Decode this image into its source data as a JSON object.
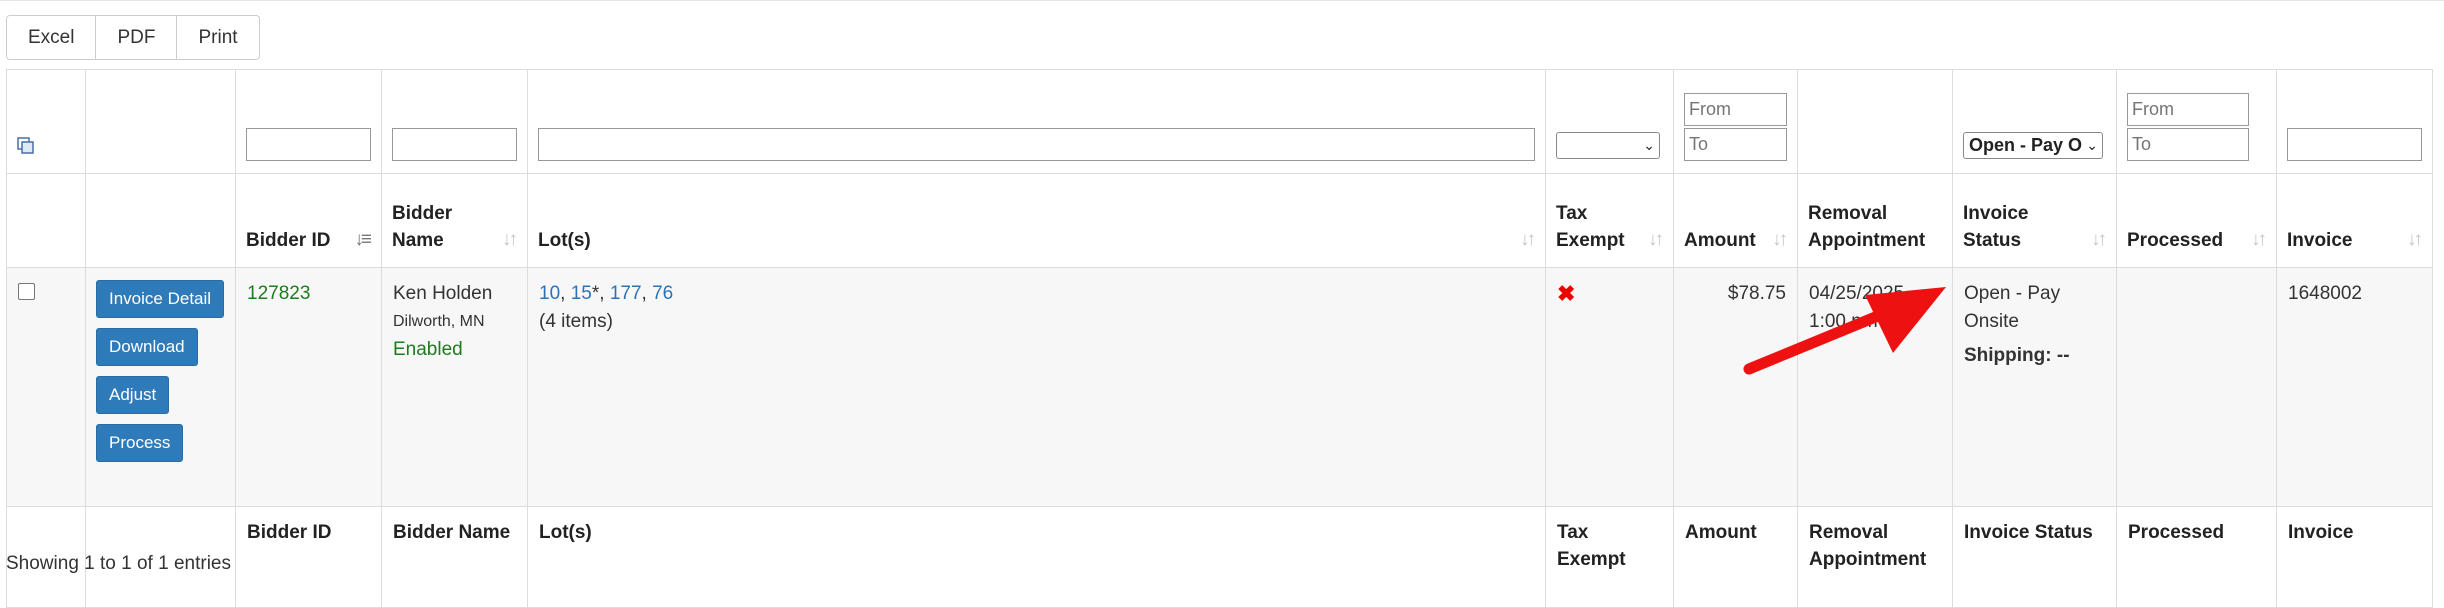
{
  "export_buttons": {
    "excel": "Excel",
    "pdf": "PDF",
    "print": "Print"
  },
  "filters": {
    "amount_from": "From",
    "amount_to": "To",
    "invoice_status_selected": "Open - Pay Onsite",
    "processed_from": "From",
    "processed_to": "To"
  },
  "columns": {
    "bidder_id": "Bidder ID",
    "bidder_name": [
      "Bidder",
      "Name"
    ],
    "lots": "Lot(s)",
    "tax_exempt": [
      "Tax",
      "Exempt"
    ],
    "amount": "Amount",
    "removal_appointment": [
      "Removal",
      "Appointment"
    ],
    "invoice_status": [
      "Invoice",
      "Status"
    ],
    "processed": "Processed",
    "invoice": "Invoice"
  },
  "footer_columns": {
    "bidder_id": "Bidder ID",
    "bidder_name": "Bidder Name",
    "lots": "Lot(s)",
    "tax_exempt": "Tax Exempt",
    "amount": "Amount",
    "removal_appointment": [
      "Removal",
      "Appointment"
    ],
    "invoice_status": "Invoice Status",
    "processed": "Processed",
    "invoice": "Invoice"
  },
  "row": {
    "actions": {
      "invoice_detail": "Invoice Detail",
      "download": "Download",
      "adjust": "Adjust",
      "process": "Process"
    },
    "bidder_id": "127823",
    "bidder_name": "Ken Holden",
    "bidder_location": "Dilworth, MN",
    "bidder_status": "Enabled",
    "lots": [
      "10",
      "15",
      "177",
      "76"
    ],
    "lot_marker": "*",
    "lot_sep": ", ",
    "lot_count": "(4 items)",
    "tax_exempt_icon": "red-x-icon",
    "amount": "$78.75",
    "removal_date": "04/25/2025",
    "removal_time": "1:00 pm",
    "invoice_status": [
      "Open - Pay",
      "Onsite"
    ],
    "shipping": "Shipping: --",
    "processed": "",
    "invoice": "1648002"
  },
  "info_text": "Showing 1 to 1 of 1 entries",
  "colors": {
    "link": "#2e72b6",
    "primary": "#2f7ab9",
    "enabled": "#1e7b1e",
    "tax_x": "#e00000",
    "arrow": "#ee1111"
  }
}
